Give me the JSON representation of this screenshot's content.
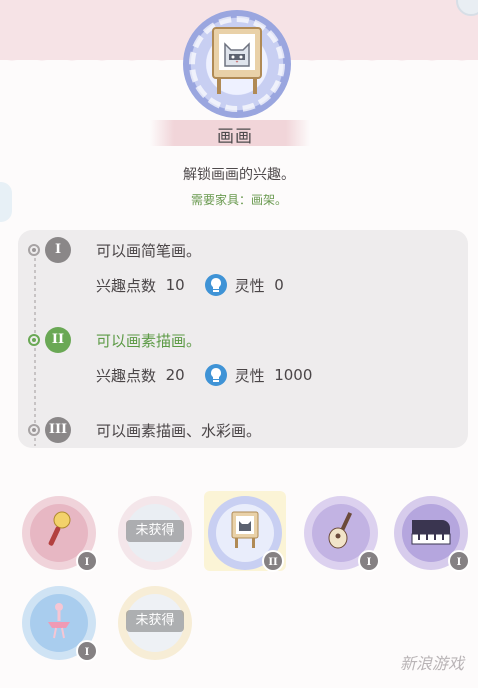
{
  "hobby": {
    "title": "画画",
    "description": "解锁画画的兴趣。",
    "requirement": "需要家具：画架。"
  },
  "levels": [
    {
      "numeral": "I",
      "text": "可以画简笔画。",
      "interest_label": "兴趣点数",
      "interest": "10",
      "spirit_label": "灵性",
      "spirit": "0"
    },
    {
      "numeral": "II",
      "text": "可以画素描画。",
      "interest_label": "兴趣点数",
      "interest": "20",
      "spirit_label": "灵性",
      "spirit": "1000"
    },
    {
      "numeral": "III",
      "text": "可以画素描画、水彩画。"
    }
  ],
  "hobbies": [
    {
      "name": "singing",
      "badge": "I",
      "locked": false
    },
    {
      "name": "locked-1",
      "locked_label": "未获得",
      "locked": true
    },
    {
      "name": "painting",
      "badge": "II",
      "selected": true
    },
    {
      "name": "guitar",
      "badge": "I"
    },
    {
      "name": "piano",
      "badge": "I"
    },
    {
      "name": "ballet",
      "badge": "I"
    },
    {
      "name": "locked-2",
      "locked_label": "未获得",
      "locked": true
    }
  ],
  "colors": {
    "accent_green": "#6aa855",
    "spirit_blue": "#3f93d6",
    "selected_bg": "#fbf4d6"
  },
  "watermark": "新浪游戏"
}
